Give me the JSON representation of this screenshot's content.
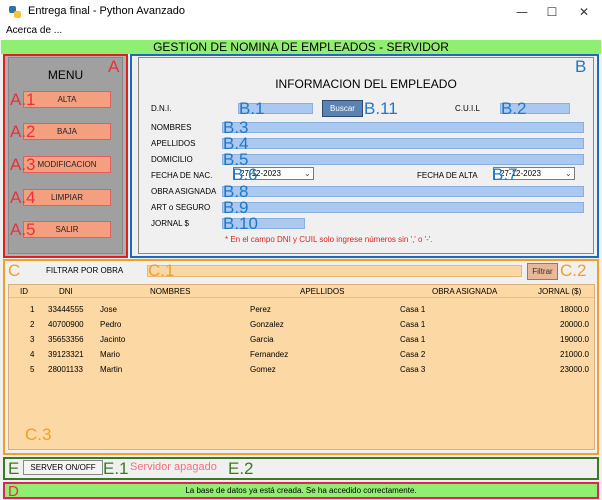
{
  "window": {
    "title": "Entrega final - Python Avanzado",
    "minimize": "—",
    "maximize": "☐",
    "close": "✕"
  },
  "menubar": {
    "acerca": "Acerca de ..."
  },
  "banner": "GESTION DE NOMINA DE EMPLEADOS - SERVIDOR",
  "overlay": {
    "A": "A",
    "A1": "A.1",
    "A2": "A.2",
    "A3": "A.3",
    "A4": "A.4",
    "A5": "A.5",
    "B": "B",
    "B1": "B.1",
    "B2": "B.2",
    "B3": "B.3",
    "B4": "B.4",
    "B5": "B.5",
    "B6": "B.6",
    "B7": "B.7",
    "B8": "B.8",
    "B9": "B.9",
    "B10": "B.10",
    "B11": "B.11",
    "C": "C",
    "C1": "C.1",
    "C2": "C.2",
    "C3": "C.3",
    "D": "D",
    "E": "E",
    "E1": "E.1",
    "E2": "E.2"
  },
  "menu": {
    "title": "MENU",
    "alta": "ALTA",
    "baja": "BAJA",
    "modificacion": "MODIFICACION",
    "limpiar": "LIMPIAR",
    "salir": "SALIR"
  },
  "form": {
    "title": "INFORMACION DEL EMPLEADO",
    "dni_label": "D.N.I.",
    "buscar": "Buscar",
    "cuil_label": "C.U.I.L",
    "nombres_label": "NOMBRES",
    "apellidos_label": "APELLIDOS",
    "domicilio_label": "DOMICILIO",
    "fecha_nac_label": "FECHA DE NAC.",
    "fecha_nac_value": "27-12-2023",
    "fecha_alta_label": "FECHA DE ALTA",
    "fecha_alta_value": "27-12-2023",
    "obra_label": "OBRA ASIGNADA",
    "art_label": "ART o SEGURO",
    "jornal_label": "JORNAL $",
    "note": "* En el campo DNI y CUIL solo ingrese números sin ',' o '-'."
  },
  "filter": {
    "label": "FILTRAR POR OBRA",
    "button": "Filtrar"
  },
  "table": {
    "headers": [
      "ID",
      "DNI",
      "NOMBRES",
      "APELLIDOS",
      "OBRA ASIGNADA",
      "JORNAL ($)"
    ],
    "rows": [
      [
        "1",
        "33444555",
        "Jose",
        "Perez",
        "Casa 1",
        "18000.0"
      ],
      [
        "2",
        "40700900",
        "Pedro",
        "Gonzalez",
        "Casa 1",
        "20000.0"
      ],
      [
        "3",
        "35653356",
        "Jacinto",
        "Garcia",
        "Casa 1",
        "19000.0"
      ],
      [
        "4",
        "39123321",
        "Mario",
        "Fernandez",
        "Casa 2",
        "21000.0"
      ],
      [
        "5",
        "28001133",
        "Martin",
        "Gomez",
        "Casa 3",
        "23000.0"
      ]
    ]
  },
  "server": {
    "button": "SERVER ON/OFF",
    "status": "Servidor apagado"
  },
  "status_bar": "La base de datos ya está creada. Se ha accedido correctamente.",
  "colors": {
    "banner": "#90ee70",
    "section_a": "#e02020",
    "section_b": "#1e6ac0",
    "section_c": "#f0a028",
    "section_d": "#e02060",
    "section_e": "#3a7a24"
  }
}
